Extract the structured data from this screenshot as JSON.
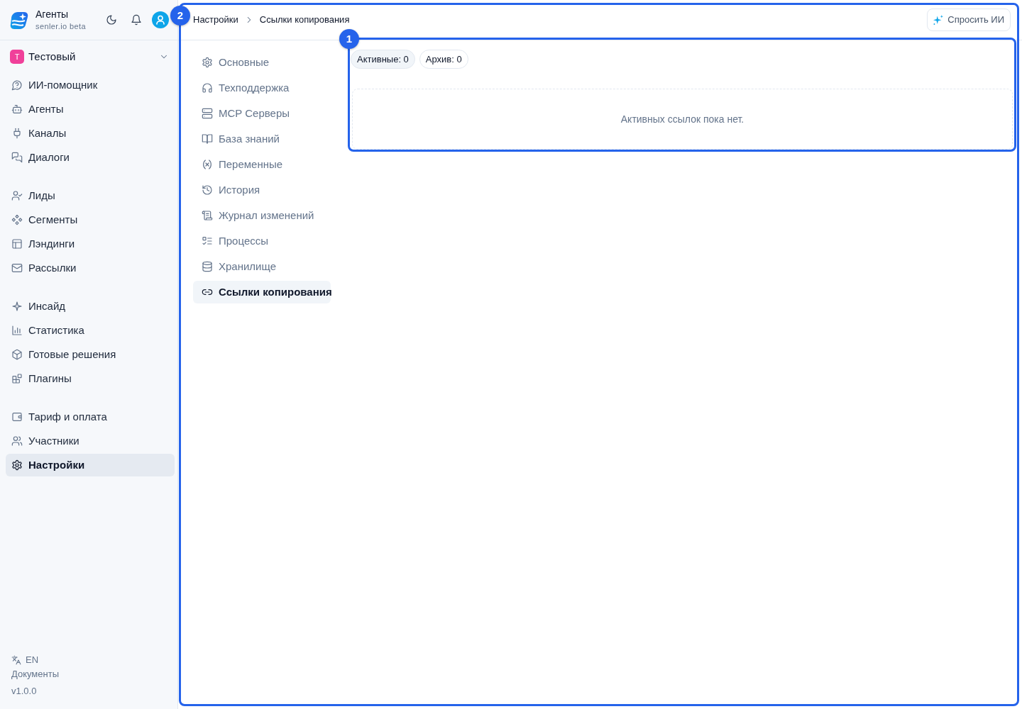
{
  "sidebar": {
    "brand": {
      "title": "Агенты",
      "subtitle": "senler.io beta"
    },
    "workspace": {
      "initial": "Т",
      "name": "Тестовый"
    },
    "groups": [
      {
        "items": [
          {
            "label": "ИИ-помощник",
            "selected": false
          },
          {
            "label": "Агенты",
            "selected": false
          },
          {
            "label": "Каналы",
            "selected": false
          },
          {
            "label": "Диалоги",
            "selected": false
          }
        ]
      },
      {
        "items": [
          {
            "label": "Лиды",
            "selected": false
          },
          {
            "label": "Сегменты",
            "selected": false
          },
          {
            "label": "Лэндинги",
            "selected": false
          },
          {
            "label": "Рассылки",
            "selected": false
          }
        ]
      },
      {
        "items": [
          {
            "label": "Инсайд",
            "selected": false
          },
          {
            "label": "Статистика",
            "selected": false
          },
          {
            "label": "Готовые решения",
            "selected": false
          },
          {
            "label": "Плагины",
            "selected": false
          }
        ]
      },
      {
        "items": [
          {
            "label": "Тариф и оплата",
            "selected": false
          },
          {
            "label": "Участники",
            "selected": false
          },
          {
            "label": "Настройки",
            "selected": true
          }
        ]
      }
    ],
    "footer": {
      "language": "EN",
      "docs_link": "Документы",
      "version": "v1.0.0"
    }
  },
  "header": {
    "breadcrumbs": [
      "Настройки",
      "Ссылки копирования"
    ],
    "ask_ai_button": "Спросить ИИ"
  },
  "settings_nav": [
    {
      "label": "Основные",
      "selected": false
    },
    {
      "label": "Техподдержка",
      "selected": false
    },
    {
      "label": "MCP Серверы",
      "selected": false
    },
    {
      "label": "База знаний",
      "selected": false
    },
    {
      "label": "Переменные",
      "selected": false
    },
    {
      "label": "История",
      "selected": false
    },
    {
      "label": "Журнал изменений",
      "selected": false
    },
    {
      "label": "Процессы",
      "selected": false
    },
    {
      "label": "Хранилище",
      "selected": false
    },
    {
      "label": "Ссылки копирования",
      "selected": true
    }
  ],
  "link_tabs": [
    {
      "label": "Активные: 0",
      "selected": true
    },
    {
      "label": "Архив: 0",
      "selected": false
    }
  ],
  "empty_state": "Активных ссылок пока нет.",
  "annotations": [
    {
      "label": "1"
    },
    {
      "label": "2"
    }
  ]
}
